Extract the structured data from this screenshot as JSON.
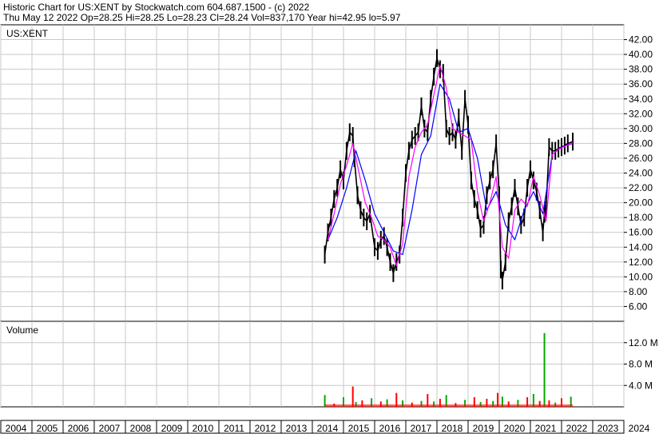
{
  "header": {
    "line1": "Historic Chart for US:XENT by Stockwatch.com 604.687.1500 - (c) 2022",
    "line2": "Thu May 12 2022   Op=28.25   Hi=28.25   Lo=28.23   Cl=28.24   Vol=837,170   Year hi=42.95   lo=5.97"
  },
  "colors": {
    "price_bar": "#000000",
    "ma_short": "#ff00ff",
    "ma_long": "#0000ff",
    "vol_up": "#00aa00",
    "vol_down": "#ff0000",
    "grid": "#c8c8c8"
  },
  "chart_data": [
    {
      "type": "line",
      "label": "US:XENT",
      "price_axis": {
        "ylim": [
          4.0,
          44.0
        ],
        "ticks": [
          "42.00",
          "40.00",
          "38.00",
          "36.00",
          "34.00",
          "32.00",
          "30.00",
          "28.00",
          "26.00",
          "24.00",
          "22.00",
          "20.00",
          "18.00",
          "16.00",
          "14.00",
          "12.00",
          "10.00",
          "8.00",
          "6.00"
        ],
        "tick_values": [
          42,
          40,
          38,
          36,
          34,
          32,
          30,
          28,
          26,
          24,
          22,
          20,
          18,
          16,
          14,
          12,
          10,
          8,
          6
        ]
      },
      "x_axis": {
        "labels": [
          "2004",
          "2005",
          "2006",
          "2007",
          "2008",
          "2009",
          "2010",
          "2011",
          "2012",
          "2013",
          "2014",
          "2015",
          "2016",
          "2017",
          "2018",
          "2019",
          "2020",
          "2021",
          "2022",
          "2023",
          "2024"
        ],
        "xlim": [
          2004.0,
          2024.0
        ]
      },
      "series": [
        {
          "kind": "price",
          "x": [
            2014.4,
            2014.5,
            2014.6,
            2014.7,
            2014.8,
            2014.9,
            2015.0,
            2015.1,
            2015.2,
            2015.3,
            2015.35,
            2015.45,
            2015.55,
            2015.65,
            2015.75,
            2015.85,
            2016.0,
            2016.1,
            2016.2,
            2016.3,
            2016.4,
            2016.5,
            2016.6,
            2016.7,
            2016.8,
            2016.9,
            2017.0,
            2017.1,
            2017.2,
            2017.3,
            2017.4,
            2017.5,
            2017.6,
            2017.7,
            2017.8,
            2017.9,
            2018.0,
            2018.1,
            2018.2,
            2018.3,
            2018.4,
            2018.5,
            2018.6,
            2018.7,
            2018.8,
            2018.9,
            2019.0,
            2019.1,
            2019.2,
            2019.3,
            2019.4,
            2019.5,
            2019.6,
            2019.7,
            2019.8,
            2019.9,
            2020.0,
            2020.05,
            2020.1,
            2020.2,
            2020.3,
            2020.4,
            2020.5,
            2020.6,
            2020.7,
            2020.8,
            2020.9,
            2021.0,
            2021.1,
            2021.2,
            2021.3,
            2021.4,
            2021.45,
            2021.5,
            2021.6,
            2021.7,
            2021.8,
            2021.9,
            2022.0,
            2022.1,
            2022.2,
            2022.36
          ],
          "values": [
            13.0,
            16.0,
            18.0,
            20.5,
            22.0,
            24.5,
            23.0,
            27.0,
            29.5,
            29.0,
            26.0,
            21.0,
            19.0,
            18.0,
            17.5,
            18.5,
            14.0,
            13.5,
            15.0,
            15.5,
            14.0,
            12.0,
            10.5,
            12.0,
            13.0,
            18.0,
            24.0,
            27.0,
            28.5,
            29.0,
            29.5,
            33.0,
            30.0,
            29.5,
            34.0,
            37.0,
            39.5,
            38.0,
            37.5,
            30.0,
            29.0,
            29.5,
            28.5,
            31.5,
            27.0,
            34.0,
            30.5,
            23.0,
            20.5,
            19.0,
            16.5,
            17.0,
            21.0,
            23.0,
            24.5,
            28.0,
            21.0,
            11.0,
            9.5,
            12.0,
            17.5,
            19.5,
            22.0,
            19.5,
            17.0,
            18.0,
            22.0,
            24.5,
            23.0,
            21.5,
            19.0,
            16.0,
            18.5,
            19.0,
            27.5,
            27.0,
            27.0,
            27.3,
            27.5,
            27.7,
            28.0,
            28.24
          ]
        },
        {
          "kind": "moving_average_short",
          "x": [
            2014.5,
            2014.7,
            2014.9,
            2015.1,
            2015.3,
            2015.5,
            2015.7,
            2015.9,
            2016.1,
            2016.3,
            2016.5,
            2016.7,
            2016.9,
            2017.1,
            2017.3,
            2017.5,
            2017.7,
            2017.9,
            2018.1,
            2018.3,
            2018.5,
            2018.7,
            2018.9,
            2019.1,
            2019.3,
            2019.5,
            2019.7,
            2019.9,
            2020.1,
            2020.3,
            2020.5,
            2020.7,
            2020.9,
            2021.1,
            2021.3,
            2021.5,
            2021.7,
            2021.9,
            2022.1,
            2022.36
          ],
          "values": [
            15.0,
            18.5,
            22.5,
            25.0,
            28.0,
            24.0,
            20.0,
            18.0,
            15.5,
            15.0,
            14.0,
            11.5,
            14.5,
            23.5,
            27.5,
            29.5,
            30.5,
            34.5,
            38.5,
            35.5,
            30.0,
            29.5,
            29.0,
            28.5,
            21.5,
            17.5,
            20.0,
            23.5,
            14.0,
            12.5,
            19.0,
            20.5,
            19.5,
            23.5,
            21.0,
            17.5,
            26.5,
            27.2,
            27.6,
            28.1
          ]
        },
        {
          "kind": "moving_average_long",
          "x": [
            2014.5,
            2014.8,
            2015.1,
            2015.4,
            2015.7,
            2016.0,
            2016.3,
            2016.6,
            2016.9,
            2017.2,
            2017.5,
            2017.8,
            2018.1,
            2018.4,
            2018.7,
            2019.0,
            2019.3,
            2019.6,
            2019.9,
            2020.2,
            2020.5,
            2020.8,
            2021.1,
            2021.4,
            2021.7,
            2022.0,
            2022.36
          ],
          "values": [
            15.0,
            18.0,
            22.0,
            27.0,
            23.0,
            18.5,
            16.0,
            13.5,
            13.0,
            19.0,
            26.5,
            29.0,
            36.0,
            34.0,
            29.5,
            30.0,
            26.0,
            19.0,
            21.5,
            17.0,
            15.0,
            19.0,
            21.5,
            18.5,
            26.5,
            27.5,
            28.0
          ]
        }
      ]
    },
    {
      "type": "bar",
      "label": "Volume",
      "volume_axis": {
        "ylim": [
          0,
          16.0
        ],
        "ticks": [
          "12.0 M",
          "8.0 M",
          "4.0 M"
        ],
        "tick_values": [
          12.0,
          8.0,
          4.0
        ],
        "unit": "M"
      },
      "x": [
        2014.4,
        2014.7,
        2015.0,
        2015.3,
        2015.4,
        2015.6,
        2015.9,
        2016.2,
        2016.4,
        2016.7,
        2016.9,
        2017.2,
        2017.5,
        2017.7,
        2017.9,
        2018.1,
        2018.3,
        2018.6,
        2018.9,
        2019.2,
        2019.4,
        2019.6,
        2019.8,
        2019.95,
        2020.1,
        2020.3,
        2020.6,
        2020.9,
        2021.1,
        2021.3,
        2021.45,
        2021.6,
        2021.8,
        2022.0,
        2022.3
      ],
      "values": [
        2.2,
        0.6,
        1.8,
        3.8,
        0.9,
        1.2,
        1.6,
        1.0,
        1.4,
        2.6,
        1.2,
        0.8,
        1.1,
        2.4,
        1.0,
        1.5,
        2.2,
        0.7,
        1.3,
        1.8,
        0.9,
        1.5,
        1.1,
        2.6,
        1.9,
        1.0,
        1.3,
        1.8,
        2.4,
        1.1,
        13.8,
        1.2,
        0.8,
        1.6,
        1.9
      ]
    }
  ]
}
